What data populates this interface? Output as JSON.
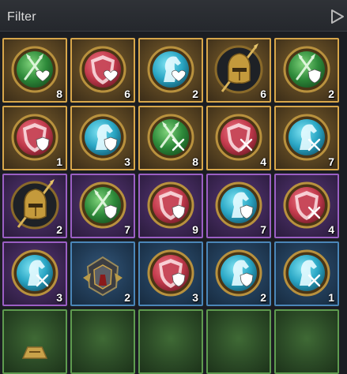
{
  "header": {
    "title": "Filter"
  },
  "colors": {
    "gold_border": "#d7a64a",
    "purple_border": "#9b5fc4",
    "blue_border": "#4a86b8",
    "green_border": "#5e9b4f"
  },
  "items": [
    {
      "name": "medal-green-sword-heart",
      "rarity": "gold",
      "count": "8"
    },
    {
      "name": "medal-red-shield-heart",
      "rarity": "gold",
      "count": "6"
    },
    {
      "name": "medal-cyan-horse-heart",
      "rarity": "gold",
      "count": "2"
    },
    {
      "name": "helmet-spear",
      "rarity": "gold",
      "count": "6"
    },
    {
      "name": "medal-green-sword-shield",
      "rarity": "gold",
      "count": "2"
    },
    {
      "name": "medal-red-shield-shield",
      "rarity": "gold",
      "count": "1"
    },
    {
      "name": "medal-cyan-horse-shield",
      "rarity": "gold",
      "count": "3"
    },
    {
      "name": "medal-green-sword-swords",
      "rarity": "gold",
      "count": "8"
    },
    {
      "name": "medal-red-shield-swords",
      "rarity": "gold",
      "count": "4"
    },
    {
      "name": "medal-cyan-horse-swords",
      "rarity": "gold",
      "count": "7"
    },
    {
      "name": "helmet-spear",
      "rarity": "purple",
      "count": "2"
    },
    {
      "name": "medal-green-sword-shield",
      "rarity": "purple",
      "count": "7"
    },
    {
      "name": "medal-red-shield-shield",
      "rarity": "purple",
      "count": "9"
    },
    {
      "name": "medal-cyan-horse-shield",
      "rarity": "purple",
      "count": "7"
    },
    {
      "name": "medal-red-shield-swords",
      "rarity": "purple",
      "count": "4"
    },
    {
      "name": "medal-cyan-horse-swords",
      "rarity": "purple",
      "count": "3"
    },
    {
      "name": "armor-emblem",
      "rarity": "blue",
      "count": "2"
    },
    {
      "name": "medal-red-shield-shield",
      "rarity": "blue",
      "count": "3"
    },
    {
      "name": "medal-cyan-horse-shield",
      "rarity": "blue",
      "count": "2"
    },
    {
      "name": "medal-cyan-horse-swords",
      "rarity": "blue",
      "count": "1"
    },
    {
      "name": "armor-gold-partial",
      "rarity": "green",
      "count": ""
    },
    {
      "name": "unknown",
      "rarity": "green",
      "count": ""
    },
    {
      "name": "unknown",
      "rarity": "green",
      "count": ""
    },
    {
      "name": "unknown",
      "rarity": "green",
      "count": ""
    },
    {
      "name": "unknown",
      "rarity": "green",
      "count": ""
    }
  ]
}
